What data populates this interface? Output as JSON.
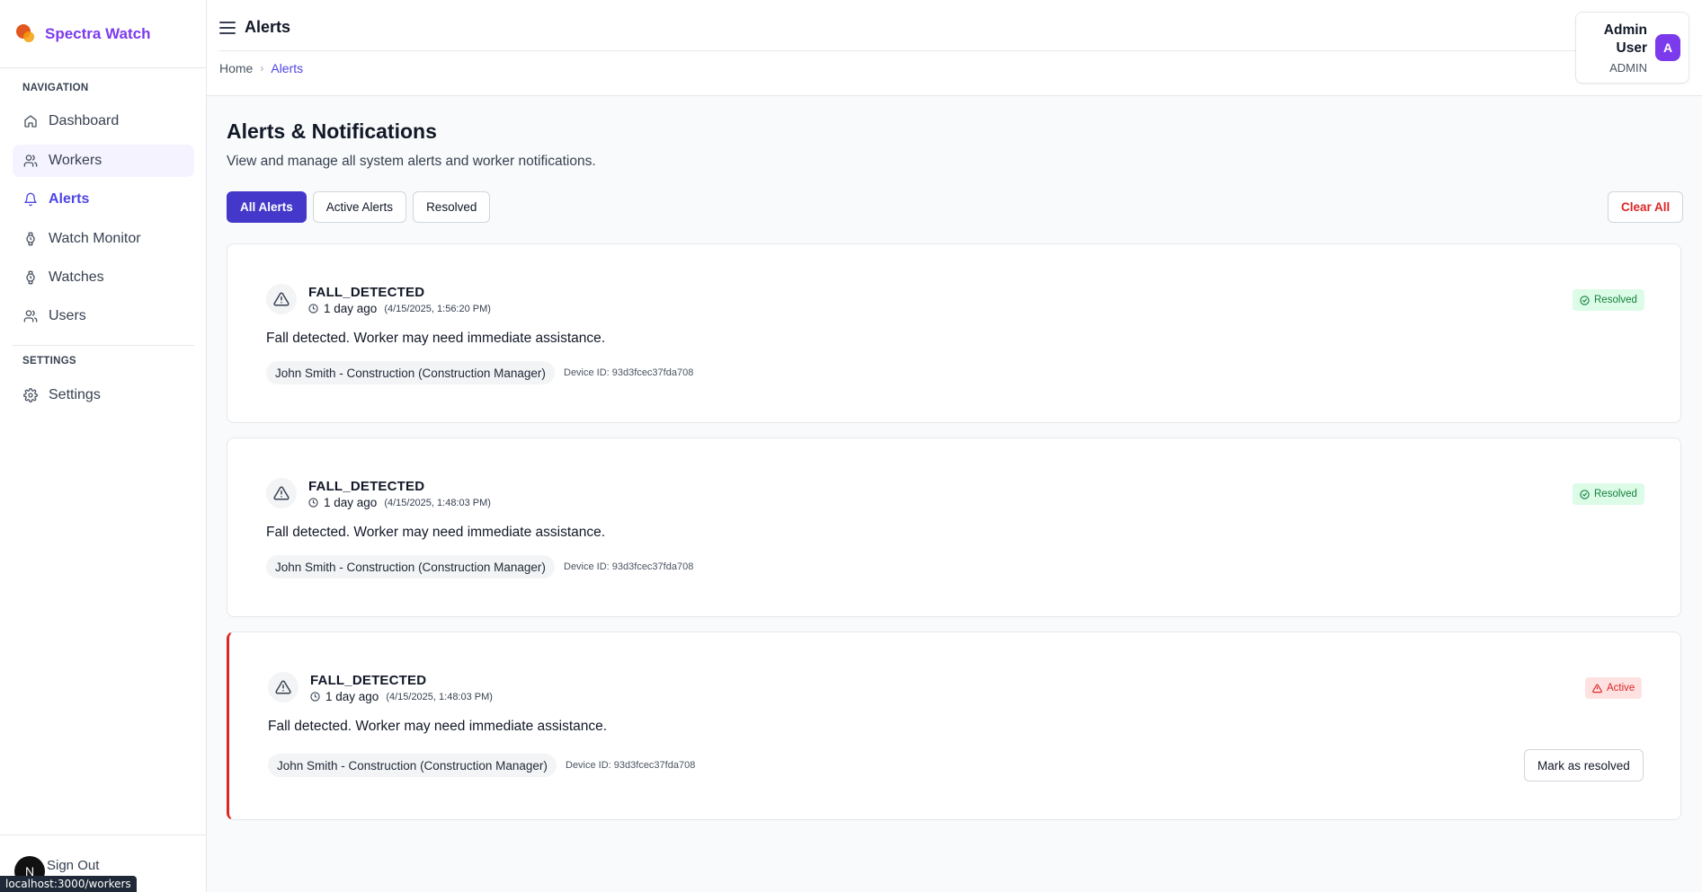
{
  "brand": {
    "name": "Spectra Watch",
    "logo_icon": "spectra-logo-icon",
    "color": "#7c3aed"
  },
  "nav": {
    "section_label": "NAVIGATION",
    "items": [
      {
        "label": "Dashboard",
        "icon": "home-icon"
      },
      {
        "label": "Workers",
        "icon": "users-icon"
      },
      {
        "label": "Alerts",
        "icon": "bell-icon"
      },
      {
        "label": "Watch Monitor",
        "icon": "watch-icon"
      },
      {
        "label": "Watches",
        "icon": "watch-icon"
      },
      {
        "label": "Users",
        "icon": "users-icon"
      }
    ],
    "settings_label": "SETTINGS",
    "settings_item": {
      "label": "Settings",
      "icon": "gear-icon"
    },
    "sign_out": "Sign Out",
    "avatar_letter": "N"
  },
  "status_bar_url": "localhost:3000/workers",
  "header": {
    "title": "Alerts",
    "breadcrumb": {
      "home": "Home",
      "current": "Alerts"
    },
    "user": {
      "name": "Admin User",
      "role": "ADMIN",
      "avatar_letter": "A"
    }
  },
  "page": {
    "title": "Alerts & Notifications",
    "subtitle": "View and manage all system alerts and worker notifications.",
    "filters": [
      "All Alerts",
      "Active Alerts",
      "Resolved"
    ],
    "active_filter": "All Alerts",
    "clear_all": "Clear All"
  },
  "alerts": [
    {
      "type": "FALL_DETECTED",
      "relative_time": "1 day ago",
      "timestamp": "(4/15/2025, 1:56:20 PM)",
      "message": "Fall detected. Worker may need immediate assistance.",
      "worker": "John Smith - Construction (Construction Manager)",
      "device": "Device ID: 93d3fcec37fda708",
      "status": "Resolved"
    },
    {
      "type": "FALL_DETECTED",
      "relative_time": "1 day ago",
      "timestamp": "(4/15/2025, 1:48:03 PM)",
      "message": "Fall detected. Worker may need immediate assistance.",
      "worker": "John Smith - Construction (Construction Manager)",
      "device": "Device ID: 93d3fcec37fda708",
      "status": "Resolved"
    },
    {
      "type": "FALL_DETECTED",
      "relative_time": "1 day ago",
      "timestamp": "(4/15/2025, 1:48:03 PM)",
      "message": "Fall detected. Worker may need immediate assistance.",
      "worker": "John Smith - Construction (Construction Manager)",
      "device": "Device ID: 93d3fcec37fda708",
      "status": "Active",
      "action": "Mark as resolved"
    }
  ],
  "colors": {
    "accent": "#4338ca",
    "danger": "#dc2626",
    "success": "#15803d"
  }
}
